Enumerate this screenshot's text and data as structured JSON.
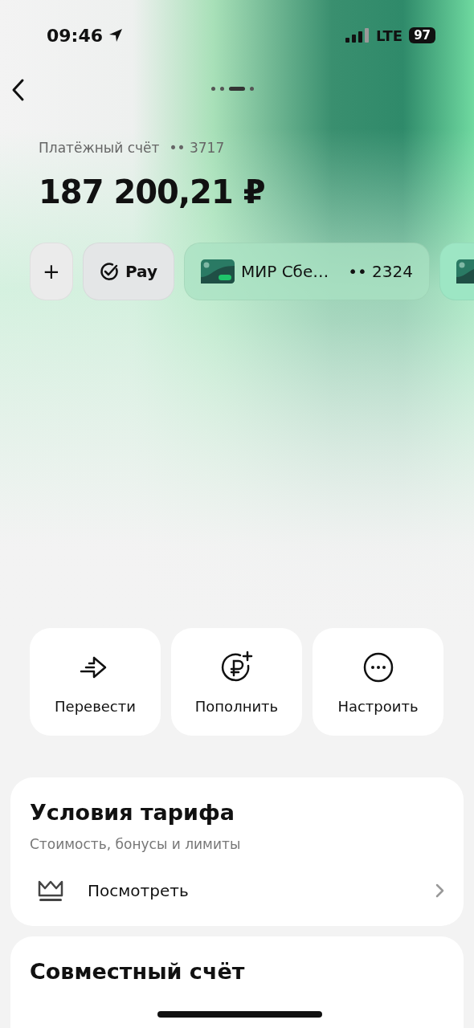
{
  "status_bar": {
    "time": "09:46",
    "network": "LTE",
    "battery": "97"
  },
  "pager": [
    {
      "selected": false
    },
    {
      "selected": false
    },
    {
      "selected": true
    },
    {
      "selected": false
    }
  ],
  "account": {
    "label": "Платёжный счёт",
    "number": "•• 3717",
    "balance": "187 200,21 ₽"
  },
  "chips": [
    {
      "kind": "add",
      "label": "+"
    },
    {
      "kind": "pay",
      "label": "Pay"
    },
    {
      "kind": "card",
      "label": "МИР Сбе…",
      "number": "•• 2324"
    },
    {
      "kind": "card-edge"
    }
  ],
  "actions": [
    {
      "kind": "transfer",
      "label": "Перевести"
    },
    {
      "kind": "topup",
      "label": "Пополнить"
    },
    {
      "kind": "more",
      "label": "Настроить"
    }
  ],
  "tariff": {
    "title": "Условия тарифа",
    "subtitle": "Стоимость, бонусы и лимиты",
    "link": "Посмотреть"
  },
  "joint": {
    "title": "Совместный счёт"
  }
}
